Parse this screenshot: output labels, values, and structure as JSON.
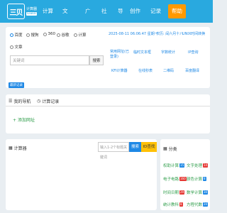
{
  "logo": {
    "mark": "三贝",
    "sub1": "计算器",
    "sub2": "SANBEI"
  },
  "nav": [
    "计算",
    "文",
    "广",
    "社",
    "导",
    "创作",
    "记录",
    "帮助"
  ],
  "nav_active_index": 7,
  "engines": [
    "百度",
    "搜狗",
    "360",
    "谷歌",
    "计算",
    "文章"
  ],
  "engines_selected": 0,
  "search": {
    "placeholder": "关键词",
    "button": "搜索"
  },
  "datetime": "2025-08-11 06:06:47 星期一",
  "lunar": "农历: 闰六月十八",
  "unix": "UNIX时间转换",
  "quick_links": [
    "常用网址(已登录)",
    "临时文本框",
    "字数统计",
    "IP查询",
    "KFI计算器",
    "在线秒表",
    "二维码",
    "百度翻译"
  ],
  "recent_tag": "最新记录",
  "tabs": {
    "nav": "我的导航",
    "calc": "计算记录"
  },
  "add_site": "添加网址",
  "calculator": {
    "title": "计算器",
    "placeholder": "输入1-2个标题关键词",
    "search_btn": "搜索",
    "id_btn": "ID查找"
  },
  "categories_title": "分类",
  "categories": [
    {
      "name": "权助计算",
      "count": "15",
      "color": "#1e88e5"
    },
    {
      "name": "文字处理",
      "count": "14",
      "color": "#e53935"
    },
    {
      "name": "电子电路",
      "count": "160",
      "color": "#e53935"
    },
    {
      "name": "颜色计算",
      "count": "8",
      "color": "#1e88e5"
    },
    {
      "name": "时间日期",
      "count": "29",
      "color": "#e53935"
    },
    {
      "name": "数学计算",
      "count": "30",
      "color": "#1e88e5"
    },
    {
      "name": "统计教科",
      "count": "8",
      "color": "#e53935"
    },
    {
      "name": "方程代数",
      "count": "20",
      "color": "#1e88e5"
    }
  ]
}
